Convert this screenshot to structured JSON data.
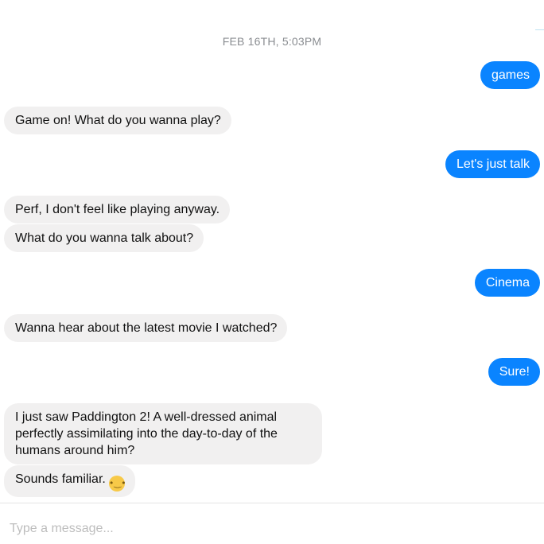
{
  "conversation": {
    "timestamp": "FEB 16TH, 5:03PM",
    "messages": [
      {
        "sender": "user",
        "text": "games"
      },
      {
        "sender": "bot",
        "text": "Game on! What do you wanna play?"
      },
      {
        "sender": "user",
        "text": "Let's just talk"
      },
      {
        "sender": "bot",
        "text": "Perf, I don't feel like playing anyway."
      },
      {
        "sender": "bot",
        "text": "What do you wanna talk about?"
      },
      {
        "sender": "user",
        "text": "Cinema"
      },
      {
        "sender": "bot",
        "text": "Wanna hear about the latest movie I watched?"
      },
      {
        "sender": "user",
        "text": "Sure!"
      },
      {
        "sender": "bot",
        "text": "I just saw Paddington 2! A well-dressed animal perfectly assimilating into the day-to-day of the humans around him?"
      },
      {
        "sender": "bot",
        "text": "Sounds familiar.",
        "emoji": "thinking-face"
      }
    ]
  },
  "composer": {
    "placeholder": "Type a message..."
  }
}
